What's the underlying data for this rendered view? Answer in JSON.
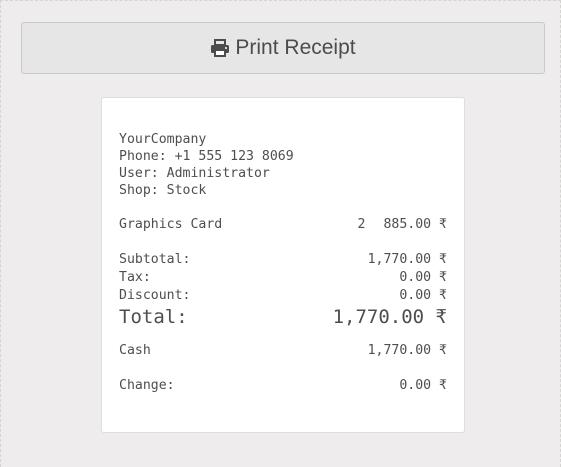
{
  "print_button": {
    "label": "Print Receipt",
    "icon": "printer-icon"
  },
  "receipt": {
    "company": "YourCompany",
    "phone": "Phone: +1 555 123 8069",
    "user": "User: Administrator",
    "shop": "Shop: Stock",
    "items": [
      {
        "name": "Graphics Card",
        "qty": "2",
        "price": "885.00 ₹"
      }
    ],
    "subtotal_label": "Subtotal:",
    "subtotal_value": "1,770.00 ₹",
    "tax_label": "Tax:",
    "tax_value": "0.00 ₹",
    "discount_label": "Discount:",
    "discount_value": "0.00 ₹",
    "total_label": "Total:",
    "total_value": "1,770.00 ₹",
    "payment_label": "Cash",
    "payment_value": "1,770.00 ₹",
    "change_label": "Change:",
    "change_value": "0.00 ₹"
  }
}
